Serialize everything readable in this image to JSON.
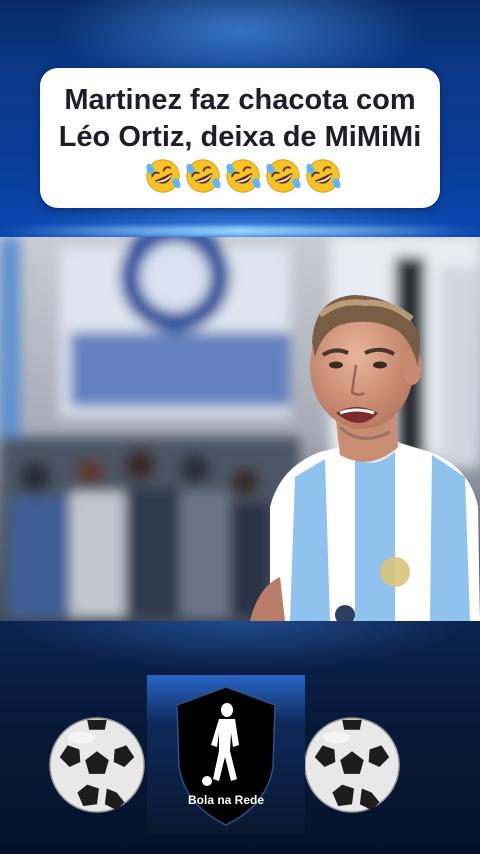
{
  "post": {
    "title_text": "Martinez faz chacota com Léo Ortiz, deixa de MiMiMi",
    "emoji_count": 5,
    "emoji_icon": "rolling-on-the-floor-laughing-emoji"
  },
  "photo": {
    "subject": "player-photo",
    "jersey_colors": [
      "#8fc3ee",
      "#ffffff"
    ]
  },
  "brand": {
    "name": "Bola na Rede",
    "logo_icon": "soccer-player-shield-icon",
    "decor_icons": [
      "soccer-ball-icon",
      "soccer-ball-icon"
    ]
  },
  "colors": {
    "banner_blue": "#0b3a8c",
    "title_text": "#1e1e2a",
    "bottom_navy": "#081a3a"
  }
}
